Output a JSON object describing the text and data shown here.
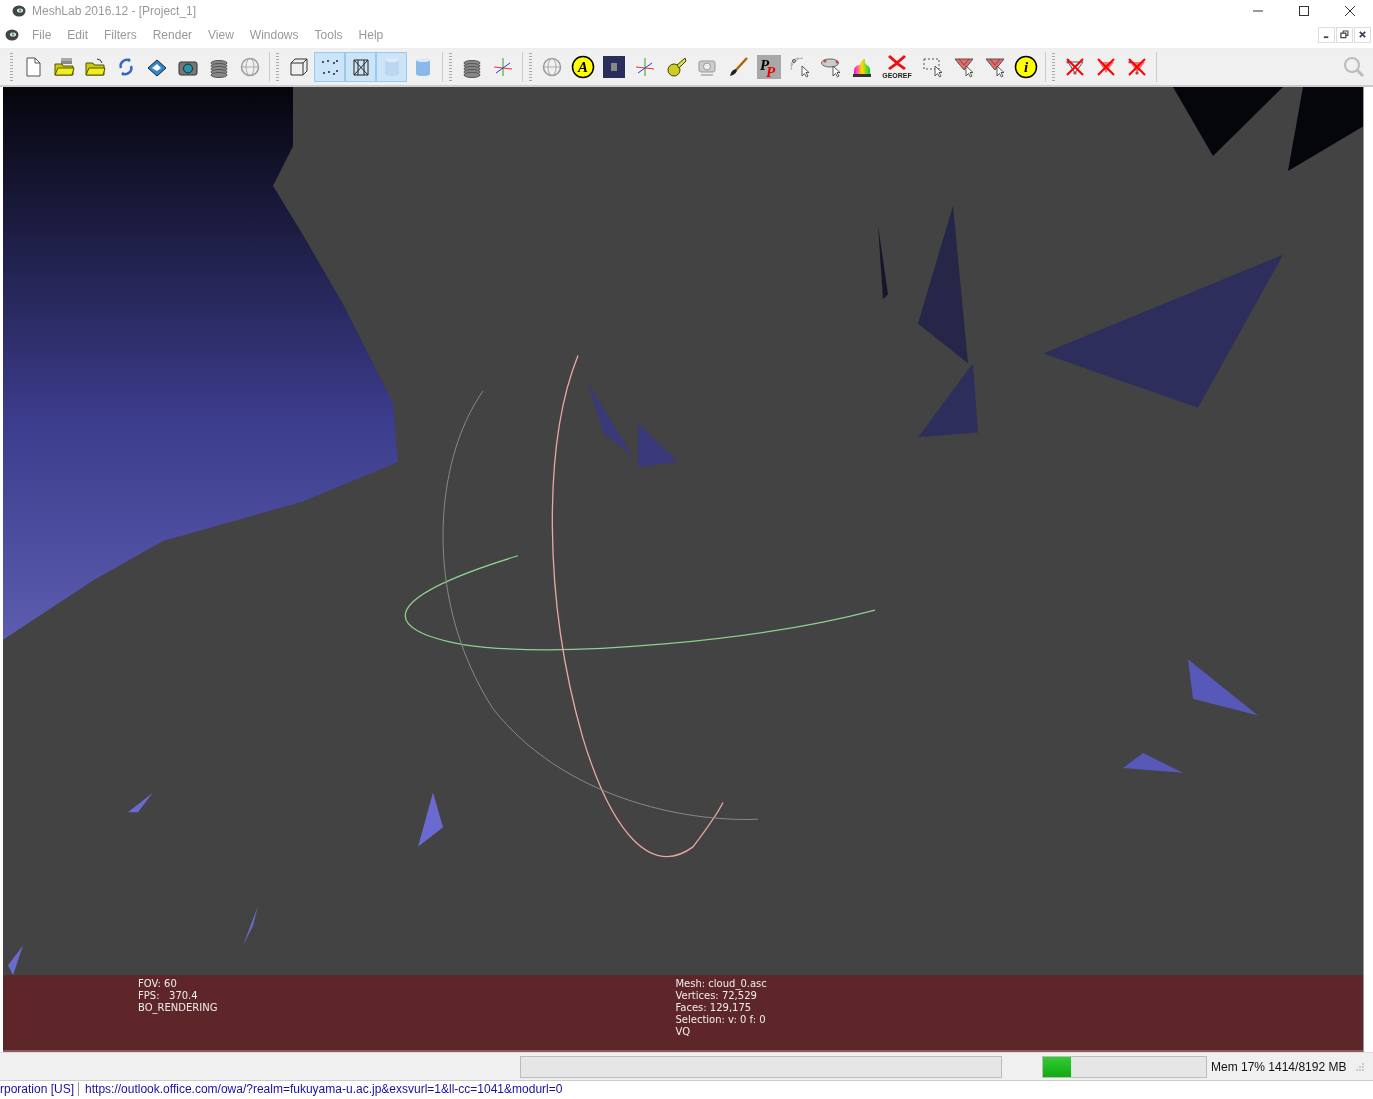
{
  "window": {
    "title": "MeshLab 2016.12 - [Project_1]"
  },
  "menu": [
    "File",
    "Edit",
    "Filters",
    "Render",
    "View",
    "Windows",
    "Tools",
    "Help"
  ],
  "toolbar_groups": [
    [
      {
        "kind": "new-file",
        "selected": false
      },
      {
        "kind": "open-project",
        "selected": false
      },
      {
        "kind": "open-folder",
        "selected": false
      },
      {
        "kind": "reload",
        "selected": false
      },
      {
        "kind": "save",
        "selected": false
      },
      {
        "kind": "camera",
        "selected": false
      },
      {
        "kind": "layers",
        "selected": false
      },
      {
        "kind": "globe-dim",
        "selected": false
      }
    ],
    [
      {
        "kind": "box",
        "selected": false
      },
      {
        "kind": "points",
        "selected": true
      },
      {
        "kind": "wireframe",
        "selected": true
      },
      {
        "kind": "cylinder",
        "selected": true
      },
      {
        "kind": "cylinder-flat",
        "selected": false
      }
    ],
    [
      {
        "kind": "layers",
        "selected": false
      },
      {
        "kind": "axes",
        "selected": false
      }
    ],
    [
      {
        "kind": "globe",
        "selected": false
      },
      {
        "kind": "circle-letter",
        "label": "A",
        "selected": false
      },
      {
        "kind": "dark-square",
        "selected": false
      },
      {
        "kind": "axes",
        "selected": false
      },
      {
        "kind": "tape",
        "selected": false
      },
      {
        "kind": "camera-dim",
        "selected": false
      },
      {
        "kind": "brush",
        "selected": false
      },
      {
        "kind": "letters",
        "label": "PP",
        "selected": false
      },
      {
        "kind": "select-arc",
        "selected": false
      },
      {
        "kind": "select-ellipse",
        "selected": false
      },
      {
        "kind": "bunny",
        "selected": false
      },
      {
        "kind": "georef",
        "label": "GEOREF",
        "selected": false
      },
      {
        "kind": "select-rect",
        "selected": false
      },
      {
        "kind": "select-faces",
        "selected": false
      },
      {
        "kind": "select-faces",
        "selected": false
      },
      {
        "kind": "circle-letter",
        "label": "i",
        "selected": false
      }
    ],
    [
      {
        "kind": "delete-vertices",
        "selected": false
      },
      {
        "kind": "delete-faces",
        "selected": false
      },
      {
        "kind": "delete-both",
        "selected": false
      }
    ]
  ],
  "overlay": {
    "left": [
      "FOV: 60",
      "FPS:   370.4",
      "BO_RENDERING"
    ],
    "right": [
      "Mesh: cloud_0.asc",
      "Vertices: 72,529",
      "Faces: 129,175",
      "Selection: v: 0 f: 0",
      "VQ"
    ]
  },
  "status_bar": {
    "progress": {
      "level": 0
    },
    "memory": {
      "level": 0.17
    },
    "memory_text": "Mem 17% 1414/8192 MB"
  },
  "background_window": {
    "left_text": "rporation [US]",
    "url": "https://outlook.office.com/owa/?realm=fukuyama-u.ac.jp&exsvurl=1&ll-cc=1041&modurl=0"
  }
}
